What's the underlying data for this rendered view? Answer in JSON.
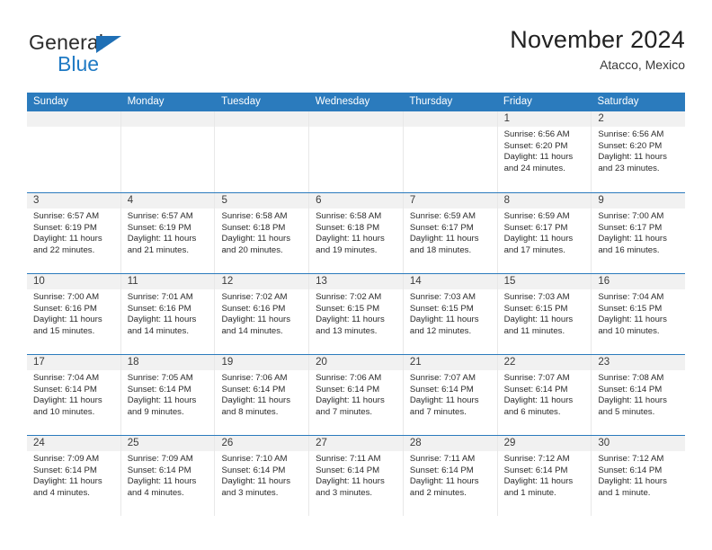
{
  "brand": {
    "name_part1": "General",
    "name_part2": "Blue",
    "triangle_icon": "blue-triangle-icon",
    "accent_color": "#1f7ac4"
  },
  "header": {
    "title": "November 2024",
    "subtitle": "Atacco, Mexico"
  },
  "theme": {
    "header_row_bg": "#2b7bbd",
    "date_band_bg": "#f1f1f1",
    "text_color": "#2b2b2b",
    "grid_line": "#e8e8e8"
  },
  "weekday_headers": [
    "Sunday",
    "Monday",
    "Tuesday",
    "Wednesday",
    "Thursday",
    "Friday",
    "Saturday"
  ],
  "labels": {
    "sunrise_prefix": "Sunrise:",
    "sunset_prefix": "Sunset:",
    "daylight_prefix": "Daylight:"
  },
  "weeks": [
    [
      {
        "day": "",
        "sunrise": "",
        "sunset": "",
        "daylight": "",
        "empty": true
      },
      {
        "day": "",
        "sunrise": "",
        "sunset": "",
        "daylight": "",
        "empty": true
      },
      {
        "day": "",
        "sunrise": "",
        "sunset": "",
        "daylight": "",
        "empty": true
      },
      {
        "day": "",
        "sunrise": "",
        "sunset": "",
        "daylight": "",
        "empty": true
      },
      {
        "day": "",
        "sunrise": "",
        "sunset": "",
        "daylight": "",
        "empty": true
      },
      {
        "day": "1",
        "sunrise": "Sunrise: 6:56 AM",
        "sunset": "Sunset: 6:20 PM",
        "daylight": "Daylight: 11 hours and 24 minutes."
      },
      {
        "day": "2",
        "sunrise": "Sunrise: 6:56 AM",
        "sunset": "Sunset: 6:20 PM",
        "daylight": "Daylight: 11 hours and 23 minutes."
      }
    ],
    [
      {
        "day": "3",
        "sunrise": "Sunrise: 6:57 AM",
        "sunset": "Sunset: 6:19 PM",
        "daylight": "Daylight: 11 hours and 22 minutes."
      },
      {
        "day": "4",
        "sunrise": "Sunrise: 6:57 AM",
        "sunset": "Sunset: 6:19 PM",
        "daylight": "Daylight: 11 hours and 21 minutes."
      },
      {
        "day": "5",
        "sunrise": "Sunrise: 6:58 AM",
        "sunset": "Sunset: 6:18 PM",
        "daylight": "Daylight: 11 hours and 20 minutes."
      },
      {
        "day": "6",
        "sunrise": "Sunrise: 6:58 AM",
        "sunset": "Sunset: 6:18 PM",
        "daylight": "Daylight: 11 hours and 19 minutes."
      },
      {
        "day": "7",
        "sunrise": "Sunrise: 6:59 AM",
        "sunset": "Sunset: 6:17 PM",
        "daylight": "Daylight: 11 hours and 18 minutes."
      },
      {
        "day": "8",
        "sunrise": "Sunrise: 6:59 AM",
        "sunset": "Sunset: 6:17 PM",
        "daylight": "Daylight: 11 hours and 17 minutes."
      },
      {
        "day": "9",
        "sunrise": "Sunrise: 7:00 AM",
        "sunset": "Sunset: 6:17 PM",
        "daylight": "Daylight: 11 hours and 16 minutes."
      }
    ],
    [
      {
        "day": "10",
        "sunrise": "Sunrise: 7:00 AM",
        "sunset": "Sunset: 6:16 PM",
        "daylight": "Daylight: 11 hours and 15 minutes."
      },
      {
        "day": "11",
        "sunrise": "Sunrise: 7:01 AM",
        "sunset": "Sunset: 6:16 PM",
        "daylight": "Daylight: 11 hours and 14 minutes."
      },
      {
        "day": "12",
        "sunrise": "Sunrise: 7:02 AM",
        "sunset": "Sunset: 6:16 PM",
        "daylight": "Daylight: 11 hours and 14 minutes."
      },
      {
        "day": "13",
        "sunrise": "Sunrise: 7:02 AM",
        "sunset": "Sunset: 6:15 PM",
        "daylight": "Daylight: 11 hours and 13 minutes."
      },
      {
        "day": "14",
        "sunrise": "Sunrise: 7:03 AM",
        "sunset": "Sunset: 6:15 PM",
        "daylight": "Daylight: 11 hours and 12 minutes."
      },
      {
        "day": "15",
        "sunrise": "Sunrise: 7:03 AM",
        "sunset": "Sunset: 6:15 PM",
        "daylight": "Daylight: 11 hours and 11 minutes."
      },
      {
        "day": "16",
        "sunrise": "Sunrise: 7:04 AM",
        "sunset": "Sunset: 6:15 PM",
        "daylight": "Daylight: 11 hours and 10 minutes."
      }
    ],
    [
      {
        "day": "17",
        "sunrise": "Sunrise: 7:04 AM",
        "sunset": "Sunset: 6:14 PM",
        "daylight": "Daylight: 11 hours and 10 minutes."
      },
      {
        "day": "18",
        "sunrise": "Sunrise: 7:05 AM",
        "sunset": "Sunset: 6:14 PM",
        "daylight": "Daylight: 11 hours and 9 minutes."
      },
      {
        "day": "19",
        "sunrise": "Sunrise: 7:06 AM",
        "sunset": "Sunset: 6:14 PM",
        "daylight": "Daylight: 11 hours and 8 minutes."
      },
      {
        "day": "20",
        "sunrise": "Sunrise: 7:06 AM",
        "sunset": "Sunset: 6:14 PM",
        "daylight": "Daylight: 11 hours and 7 minutes."
      },
      {
        "day": "21",
        "sunrise": "Sunrise: 7:07 AM",
        "sunset": "Sunset: 6:14 PM",
        "daylight": "Daylight: 11 hours and 7 minutes."
      },
      {
        "day": "22",
        "sunrise": "Sunrise: 7:07 AM",
        "sunset": "Sunset: 6:14 PM",
        "daylight": "Daylight: 11 hours and 6 minutes."
      },
      {
        "day": "23",
        "sunrise": "Sunrise: 7:08 AM",
        "sunset": "Sunset: 6:14 PM",
        "daylight": "Daylight: 11 hours and 5 minutes."
      }
    ],
    [
      {
        "day": "24",
        "sunrise": "Sunrise: 7:09 AM",
        "sunset": "Sunset: 6:14 PM",
        "daylight": "Daylight: 11 hours and 4 minutes."
      },
      {
        "day": "25",
        "sunrise": "Sunrise: 7:09 AM",
        "sunset": "Sunset: 6:14 PM",
        "daylight": "Daylight: 11 hours and 4 minutes."
      },
      {
        "day": "26",
        "sunrise": "Sunrise: 7:10 AM",
        "sunset": "Sunset: 6:14 PM",
        "daylight": "Daylight: 11 hours and 3 minutes."
      },
      {
        "day": "27",
        "sunrise": "Sunrise: 7:11 AM",
        "sunset": "Sunset: 6:14 PM",
        "daylight": "Daylight: 11 hours and 3 minutes."
      },
      {
        "day": "28",
        "sunrise": "Sunrise: 7:11 AM",
        "sunset": "Sunset: 6:14 PM",
        "daylight": "Daylight: 11 hours and 2 minutes."
      },
      {
        "day": "29",
        "sunrise": "Sunrise: 7:12 AM",
        "sunset": "Sunset: 6:14 PM",
        "daylight": "Daylight: 11 hours and 1 minute."
      },
      {
        "day": "30",
        "sunrise": "Sunrise: 7:12 AM",
        "sunset": "Sunset: 6:14 PM",
        "daylight": "Daylight: 11 hours and 1 minute."
      }
    ]
  ]
}
